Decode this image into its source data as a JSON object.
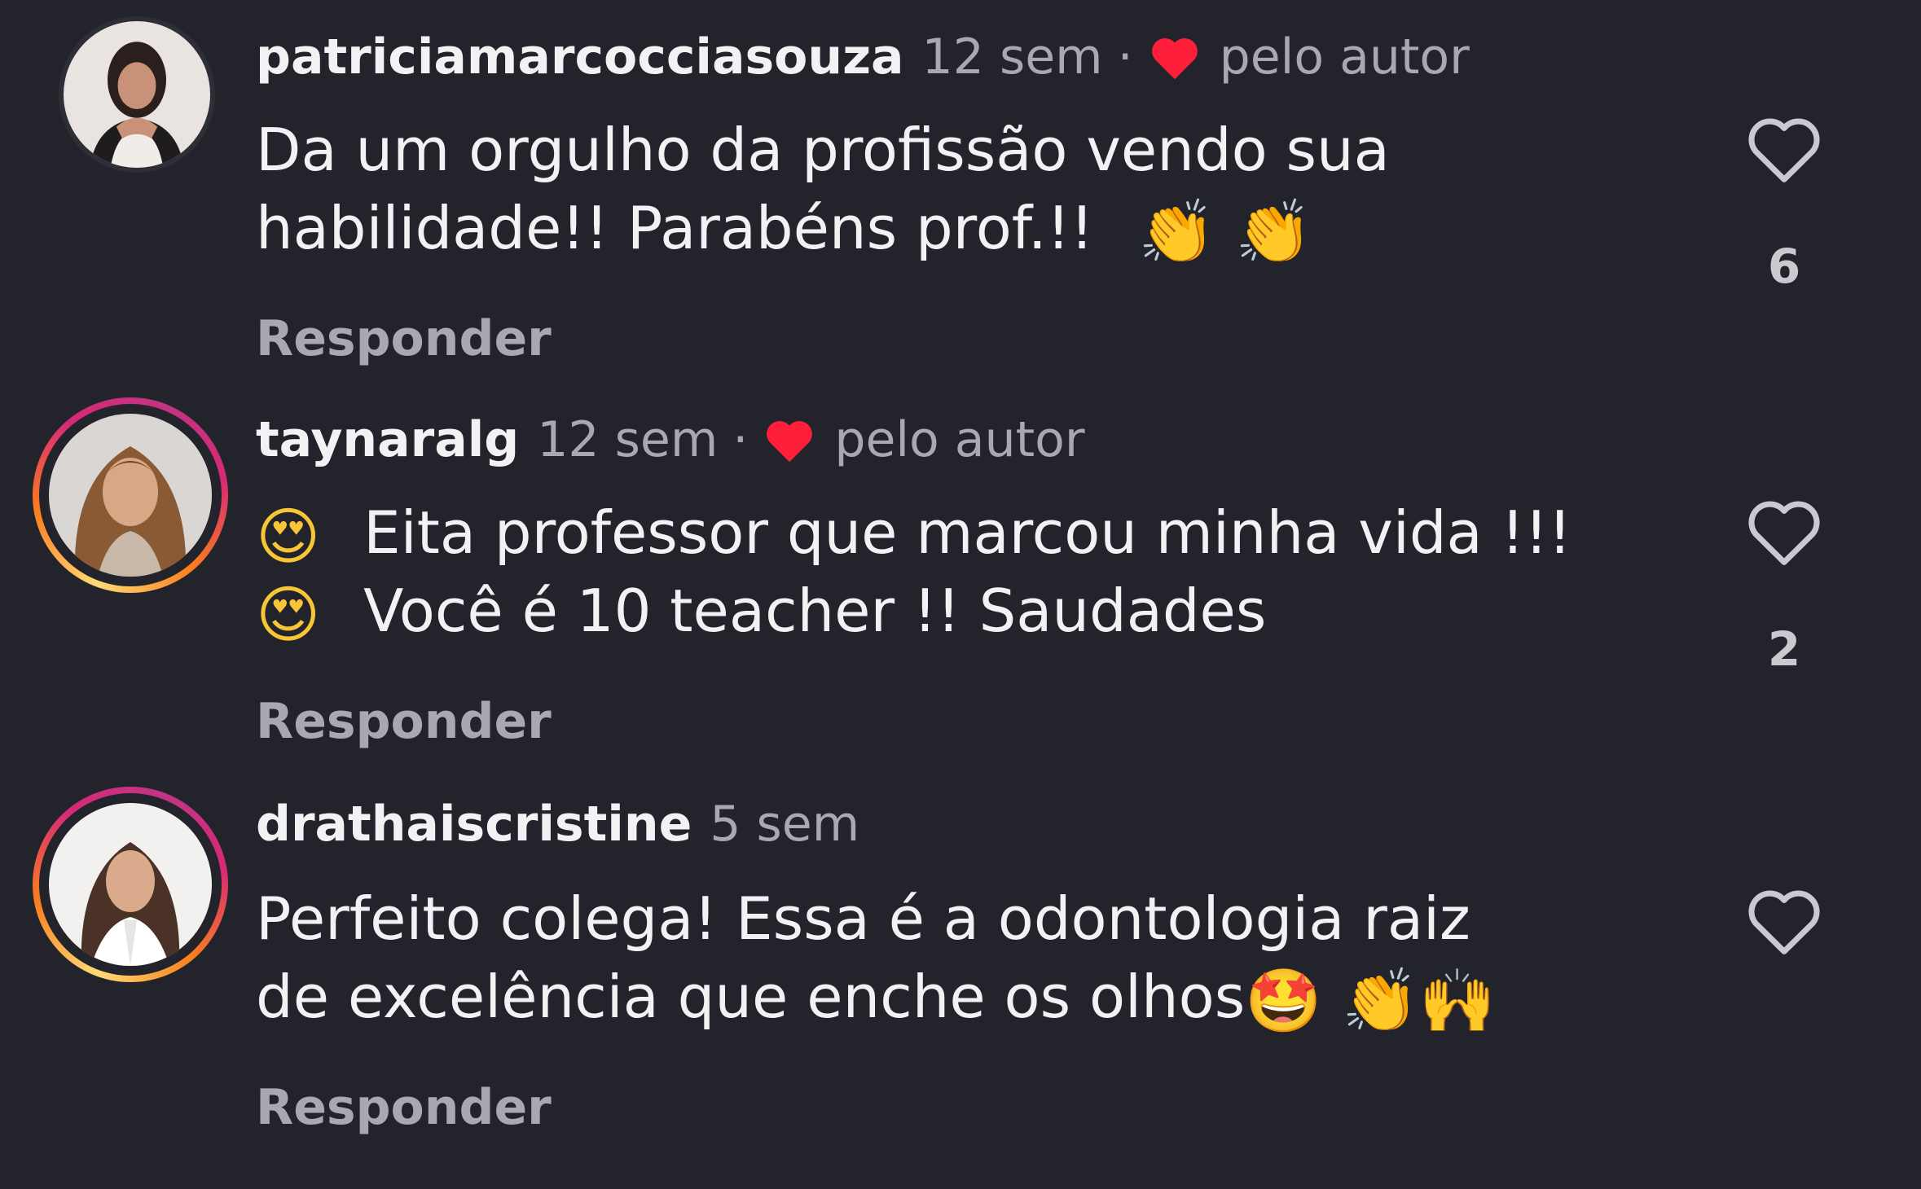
{
  "comments": [
    {
      "username": "patriciamarcocciasouza",
      "time": "12 sem",
      "dot": "·",
      "by_author": "pelo autor",
      "line1": "Da um orgulho da profissão vendo sua",
      "line2": "habilidade!! Parabéns prof.!!",
      "line2_emoji": "👏 👏",
      "reply": "Responder",
      "likes": "6",
      "avatar_ring": "none"
    },
    {
      "username": "taynaralg",
      "time": "12 sem",
      "dot": "·",
      "by_author": "pelo autor",
      "line1_emoji": "😍",
      "line1": "Eita professor que marcou minha vida !!!",
      "line2_emoji": "😍",
      "line2": "Você é 10 teacher !! Saudades",
      "reply": "Responder",
      "likes": "2",
      "avatar_ring": "story"
    },
    {
      "username": "drathaiscristine",
      "time": "5 sem",
      "line1": "Perfeito colega! Essa é a odontologia raiz",
      "line2": "de excelência que enche os olhos",
      "line2_emoji": "🤩 👏🙌",
      "reply": "Responder",
      "avatar_ring": "story"
    }
  ],
  "colors": {
    "background": "#23242b",
    "primary_text": "#f2f2f4",
    "secondary_text": "#a8a8b0",
    "liked_heart": "#ff1f3a",
    "story_ring": [
      "#feda75",
      "#fa7e1e",
      "#d62976",
      "#c13584"
    ]
  },
  "icons": {
    "liked_by_author": "filled-heart-icon",
    "like_button": "heart-outline-icon"
  }
}
